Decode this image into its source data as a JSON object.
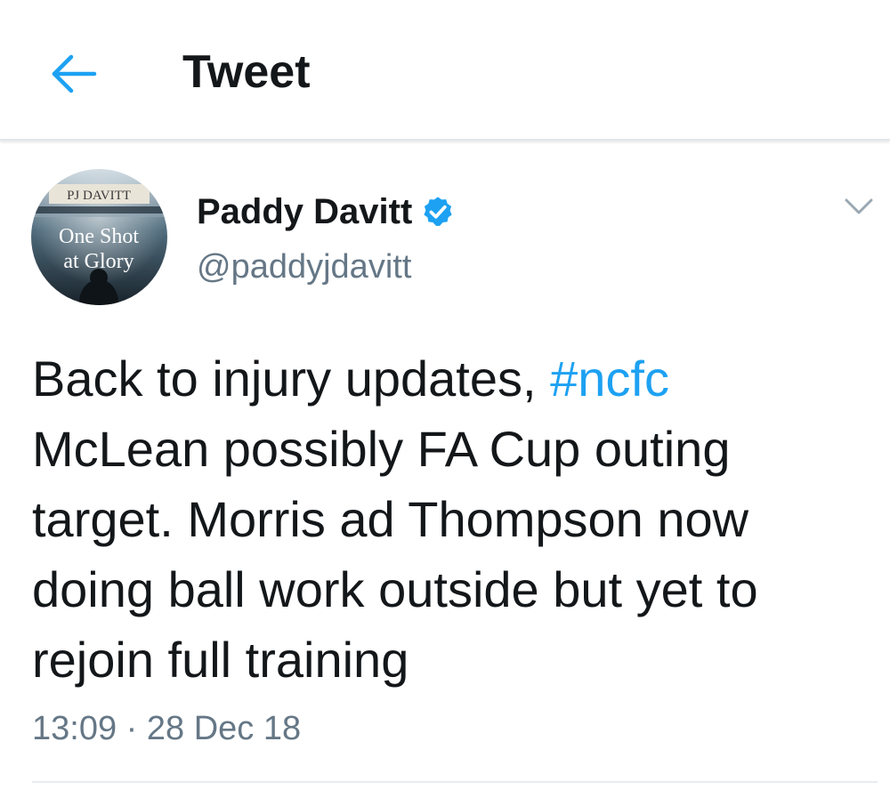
{
  "header": {
    "title": "Tweet",
    "back_icon": "arrow-left-icon"
  },
  "tweet": {
    "author": {
      "name": "Paddy Davitt",
      "handle": "@paddyjdavitt",
      "verified": true,
      "avatar": {
        "top_text": "PJ DAVITT",
        "line1": "One Shot",
        "line2": "at Glory"
      }
    },
    "body_before": "Back to injury updates, ",
    "hashtag": "#ncfc",
    "body_after": "\nMcLean possibly FA Cup outing\ntarget. Morris ad Thompson now\ndoing ball work outside but yet to\nrejoin full training",
    "time": "13:09",
    "separator": "·",
    "date": "28 Dec 18",
    "menu_icon": "chevron-down-icon"
  },
  "colors": {
    "accent": "#1da1f2",
    "text": "#14171a",
    "muted": "#657786"
  }
}
